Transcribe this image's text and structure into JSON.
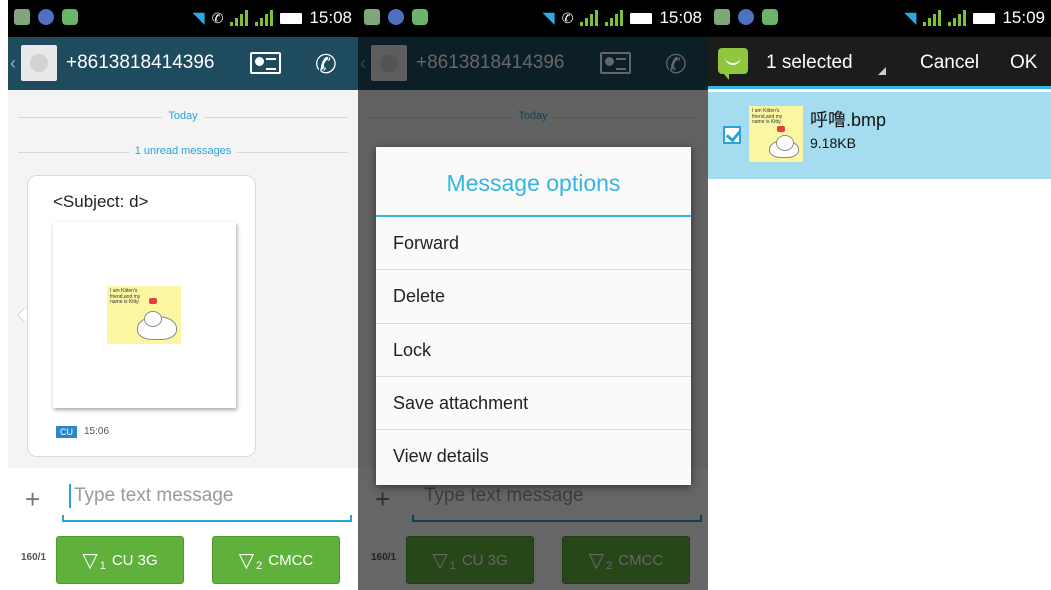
{
  "status_bar": {
    "time_1": "15:08",
    "time_2": "15:08",
    "time_3": "15:09"
  },
  "conversation": {
    "title": "+8613818414396",
    "date_separator": "Today",
    "unread_separator": "1 unread messages",
    "message": {
      "subject": "<Subject: d>",
      "attachment_caption": "I am Kitten's friend,and my name is Kitty.",
      "sim_tag": "CU",
      "time": "15:06"
    },
    "compose_placeholder": "Type text message",
    "char_counter": "160/1",
    "send_buttons": [
      {
        "label": "CU 3G",
        "sim_index": "1"
      },
      {
        "label": "CMCC",
        "sim_index": "2"
      }
    ]
  },
  "message_options_dialog": {
    "title": "Message options",
    "items": [
      "Forward",
      "Delete",
      "Lock",
      "Save attachment",
      "View details"
    ]
  },
  "selection_mode": {
    "selected_count": "1 selected",
    "cancel_label": "Cancel",
    "ok_label": "OK",
    "attachment": {
      "name": "呼噜.bmp",
      "size": "9.18KB",
      "checked": true
    }
  },
  "colors": {
    "action_bar": "#1f4b5f",
    "accent": "#33b5e5",
    "send_button": "#5fb13b",
    "selected_row": "#a6dcef"
  }
}
